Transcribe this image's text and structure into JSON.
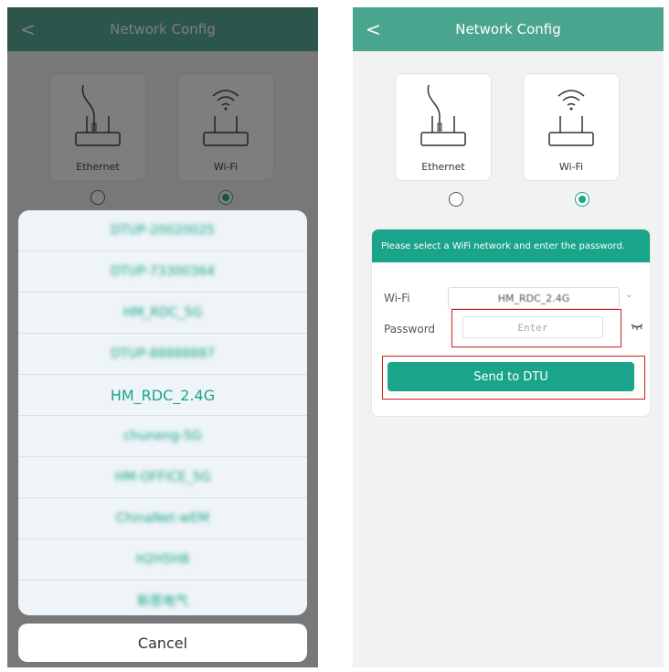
{
  "header": {
    "title": "Network Config",
    "back_icon": "<"
  },
  "modes": [
    {
      "label": "Ethernet",
      "selected": false
    },
    {
      "label": "Wi-Fi",
      "selected": true
    }
  ],
  "network_list": [
    "DTUP-20020025",
    "DTUP-73300364",
    "HM_RDC_5G",
    "DTUP-88888887",
    "HM_RDC_2.4G",
    "chuneng-5G",
    "HM-OFFICE_5G",
    "ChinaNet-wEM",
    "H2H5H8",
    "新思电气"
  ],
  "selected_network_index": 4,
  "cancel_label": "Cancel",
  "form": {
    "instruction": "Please select a WiFi network and enter the password.",
    "wifi_label": "Wi-Fi",
    "wifi_value": "HM_RDC_2.4G",
    "password_label": "Password",
    "password_placeholder": "Enter",
    "send_label": "Send to DTU"
  },
  "colors": {
    "accent": "#1aa58a",
    "header": "#4aa58f",
    "highlight": "#d11f1f"
  }
}
